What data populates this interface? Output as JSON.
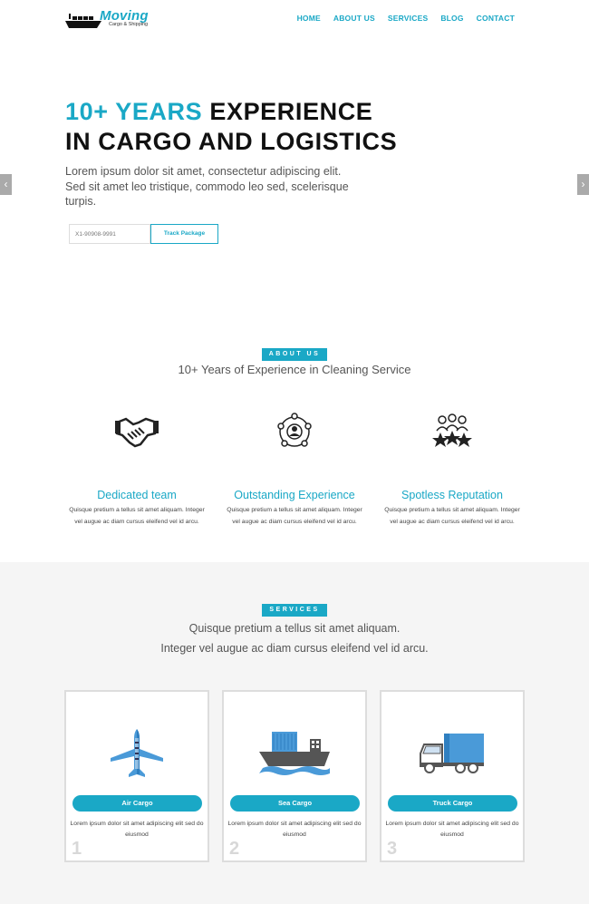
{
  "brand": {
    "name": "Moving",
    "tagline": "Cargo & Shipping"
  },
  "nav": [
    "HOME",
    "ABOUT US",
    "SERVICES",
    "BLOG",
    "CONTACT"
  ],
  "hero": {
    "title_accent": "10+ YEARS",
    "title_rest": "EXPERIENCE",
    "title_line2": "IN CARGO AND LOGISTICS",
    "text": "Lorem ipsum dolor sit amet, consectetur adipiscing elit. Sed sit amet leo tristique, commodo leo sed, scelerisque turpis.",
    "track_value": "X1-90908-9991",
    "track_button": "Track Package",
    "arrow_left": "‹",
    "arrow_right": "›"
  },
  "about": {
    "badge": "ABOUT US",
    "subtitle": "10+ Years of Experience in Cleaning Service",
    "features": [
      {
        "icon": "handshake-icon",
        "title": "Dedicated team",
        "text": "Quisque pretium a tellus sit amet aliquam. Integer vel augue ac diam cursus eleifend vel id arcu."
      },
      {
        "icon": "network-icon",
        "title": "Outstanding Experience",
        "text": "Quisque pretium a tellus sit amet aliquam. Integer vel augue ac diam cursus eleifend vel id arcu."
      },
      {
        "icon": "team-stars-icon",
        "title": "Spotless Reputation",
        "text": "Quisque pretium a tellus sit amet aliquam. Integer vel augue ac diam cursus eleifend vel id arcu."
      }
    ]
  },
  "services": {
    "badge": "SERVICES",
    "line1": "Quisque pretium a tellus sit amet aliquam.",
    "line2": "Integer vel augue ac diam cursus eleifend vel id arcu.",
    "cards": [
      {
        "icon": "airplane-icon",
        "label": "Air Cargo",
        "text": "Lorem ipsum dolor sit amet adipiscing elit sed do eiusmod",
        "num": "1"
      },
      {
        "icon": "cargo-ship-icon",
        "label": "Sea Cargo",
        "text": "Lorem ipsum dolor sit amet adipiscing elit sed do eiusmod",
        "num": "2"
      },
      {
        "icon": "truck-icon",
        "label": "Truck Cargo",
        "text": "Lorem ipsum dolor sit amet adipiscing elit sed do eiusmod",
        "num": "3"
      }
    ]
  },
  "colors": {
    "accent": "#1aa8c6",
    "dark": "#111111",
    "light_bg": "#f5f5f5"
  }
}
